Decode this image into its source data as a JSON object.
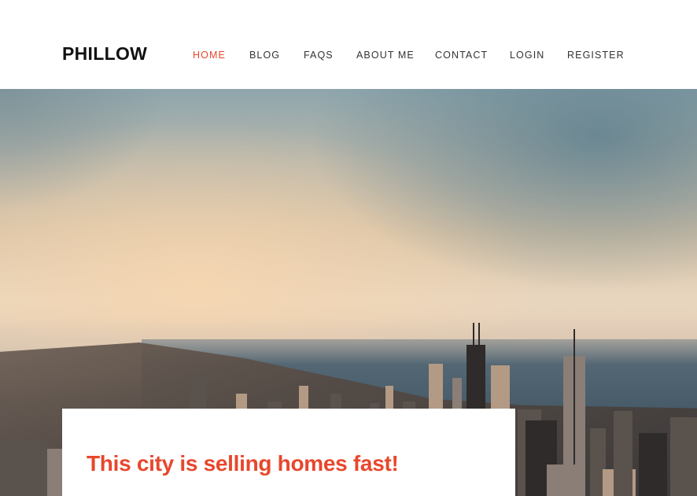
{
  "brand": {
    "logo": "PHILLOW"
  },
  "nav": {
    "items": [
      {
        "label": "HOME",
        "active": true
      },
      {
        "label": "BLOG",
        "active": false
      },
      {
        "label": "FAQS",
        "active": false
      },
      {
        "label": "ABOUT ME",
        "active": false
      },
      {
        "label": "CONTACT",
        "active": false
      },
      {
        "label": "LOGIN",
        "active": false
      },
      {
        "label": "REGISTER",
        "active": false
      }
    ]
  },
  "hero": {
    "image": "city-skyline-photo",
    "card": {
      "title": "This city is selling homes fast!"
    }
  },
  "colors": {
    "accent": "#e8472c",
    "text": "#333333",
    "logo": "#111111",
    "background": "#ffffff"
  }
}
